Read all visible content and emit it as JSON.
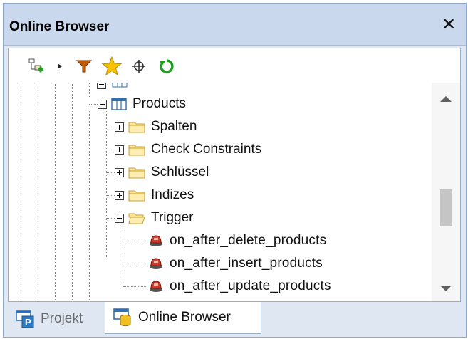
{
  "window": {
    "title": "Online Browser",
    "close_glyph": "✕"
  },
  "toolbar": {
    "icons": [
      "add-object-icon",
      "dropdown-arrow-icon",
      "filter-icon",
      "favorite-star-icon",
      "locate-target-icon",
      "refresh-icon"
    ],
    "colors": {
      "filter": "#c25a00",
      "star": "#f5b800",
      "refresh": "#1f9e1f"
    }
  },
  "tree": {
    "table": {
      "label": "Products",
      "expander": "minus"
    },
    "folders": [
      {
        "label": "Spalten",
        "expander": "plus"
      },
      {
        "label": "Check Constraints",
        "expander": "plus"
      },
      {
        "label": "Schlüssel",
        "expander": "plus"
      },
      {
        "label": "Indizes",
        "expander": "plus"
      },
      {
        "label": "Trigger",
        "expander": "minus"
      }
    ],
    "triggers": [
      {
        "label": "on_after_delete_products"
      },
      {
        "label": "on_after_insert_products"
      },
      {
        "label": "on_after_update_products"
      }
    ]
  },
  "tabs": [
    {
      "label": "Projekt",
      "active": false
    },
    {
      "label": "Online Browser",
      "active": true
    }
  ]
}
